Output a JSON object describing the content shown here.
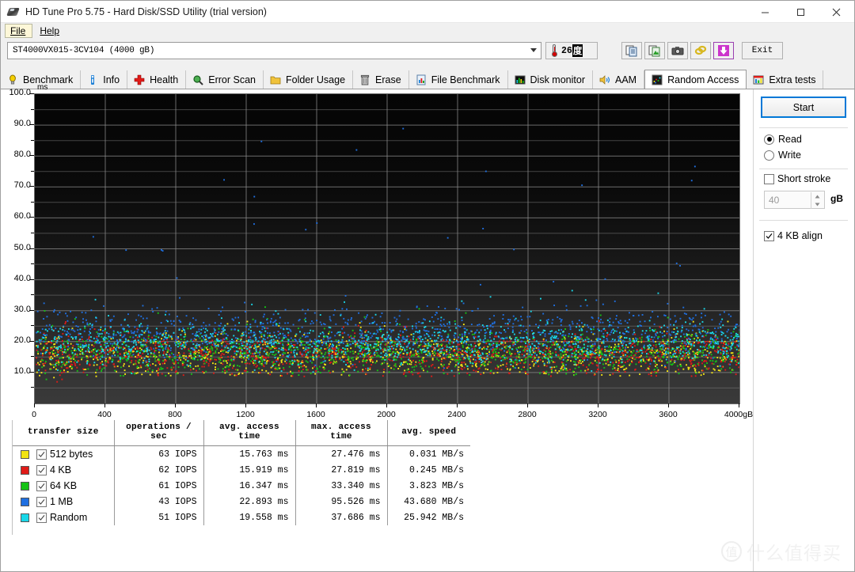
{
  "window": {
    "title": "HD Tune Pro 5.75 - Hard Disk/SSD Utility (trial version)",
    "icon": "hard-disk-icon",
    "minimize": "─",
    "maximize": "□",
    "close": "✕"
  },
  "menu": {
    "items": [
      {
        "label": "File",
        "active": true
      },
      {
        "label": "Help",
        "active": false
      }
    ]
  },
  "toolbar": {
    "drive": {
      "value": "ST4000VX015-3CV104 (4000 gB)",
      "dropdown_icon": "chevron-down-icon"
    },
    "temperature": {
      "icon": "thermometer-icon",
      "value": "26",
      "unit": "度"
    },
    "buttons": [
      {
        "name": "copy-icon",
        "label": ""
      },
      {
        "name": "copy-image-icon",
        "label": ""
      },
      {
        "name": "camera-icon",
        "label": ""
      },
      {
        "name": "link-icon",
        "label": ""
      },
      {
        "name": "download-icon",
        "label": ""
      }
    ],
    "exit_label": "Exit"
  },
  "tabs": [
    {
      "label": "Benchmark",
      "icon": "lightbulb-icon",
      "active": false
    },
    {
      "label": "Info",
      "icon": "info-icon",
      "active": false
    },
    {
      "label": "Health",
      "icon": "red-cross-icon",
      "active": false
    },
    {
      "label": "Error Scan",
      "icon": "magnifier-icon",
      "active": false
    },
    {
      "label": "Folder Usage",
      "icon": "folder-icon",
      "active": false
    },
    {
      "label": "Erase",
      "icon": "trash-icon",
      "active": false
    },
    {
      "label": "File Benchmark",
      "icon": "file-chart-icon",
      "active": false
    },
    {
      "label": "Disk monitor",
      "icon": "bar-chart-icon",
      "active": false
    },
    {
      "label": "AAM",
      "icon": "speaker-icon",
      "active": false
    },
    {
      "label": "Random Access",
      "icon": "scatter-icon",
      "active": true
    },
    {
      "label": "Extra tests",
      "icon": "chart-icon",
      "active": false
    }
  ],
  "chart_data": {
    "type": "scatter",
    "title": "",
    "xlabel": "gB",
    "ylabel": "ms",
    "yunit": "ms",
    "xunit": "gB",
    "xlim": [
      0,
      4000
    ],
    "ylim": [
      0,
      100
    ],
    "xticks": [
      0,
      400,
      800,
      1200,
      1600,
      2000,
      2400,
      2800,
      3200,
      3600,
      4000
    ],
    "xtick_labels": [
      "0",
      "400",
      "800",
      "1200",
      "1600",
      "2000",
      "2400",
      "2800",
      "3200",
      "3600",
      "4000gB"
    ],
    "yticks": [
      10,
      20,
      30,
      40,
      50,
      60,
      70,
      80,
      90,
      100
    ],
    "ytick_labels": [
      "10.0",
      "20.0",
      "30.0",
      "40.0",
      "50.0",
      "60.0",
      "70.0",
      "80.0",
      "90.0",
      "100.0"
    ],
    "grid": true,
    "background": "#0a0a0a",
    "legend_position": "below-chart",
    "series": [
      {
        "name": "512 bytes",
        "color": "#f2e313",
        "avg_ms": 15.763,
        "max_ms": 27.476,
        "count": 1100
      },
      {
        "name": "4 KB",
        "color": "#e01b18",
        "avg_ms": 15.919,
        "max_ms": 27.819,
        "count": 1100
      },
      {
        "name": "64 KB",
        "color": "#15c215",
        "avg_ms": 16.347,
        "max_ms": 33.34,
        "count": 1100
      },
      {
        "name": "1 MB",
        "color": "#1f6fe0",
        "avg_ms": 22.893,
        "max_ms": 95.526,
        "count": 1100
      },
      {
        "name": "Random",
        "color": "#19d7e8",
        "avg_ms": 19.558,
        "max_ms": 37.686,
        "count": 1100
      }
    ]
  },
  "results_table": {
    "columns": [
      "transfer size",
      "operations / sec",
      "avg. access time",
      "max. access time",
      "avg. speed"
    ],
    "rows": [
      {
        "color": "#f2e313",
        "checked": true,
        "label": "512 bytes",
        "iops": "63 IOPS",
        "avg_access": "15.763 ms",
        "max_access": "27.476 ms",
        "avg_speed": "0.031 MB/s"
      },
      {
        "color": "#e01b18",
        "checked": true,
        "label": "4 KB",
        "iops": "62 IOPS",
        "avg_access": "15.919 ms",
        "max_access": "27.819 ms",
        "avg_speed": "0.245 MB/s"
      },
      {
        "color": "#15c215",
        "checked": true,
        "label": "64 KB",
        "iops": "61 IOPS",
        "avg_access": "16.347 ms",
        "max_access": "33.340 ms",
        "avg_speed": "3.823 MB/s"
      },
      {
        "color": "#1f6fe0",
        "checked": true,
        "label": "1 MB",
        "iops": "43 IOPS",
        "avg_access": "22.893 ms",
        "max_access": "95.526 ms",
        "avg_speed": "43.680 MB/s"
      },
      {
        "color": "#19d7e8",
        "checked": true,
        "label": "Random",
        "iops": "51 IOPS",
        "avg_access": "19.558 ms",
        "max_access": "37.686 ms",
        "avg_speed": "25.942 MB/s"
      }
    ]
  },
  "side_panel": {
    "start_label": "Start",
    "mode": {
      "read_label": "Read",
      "write_label": "Write",
      "selected": "Read"
    },
    "short_stroke": {
      "label": "Short stroke",
      "checked": false,
      "value": "40",
      "unit": "gB"
    },
    "align": {
      "label": "4 KB align",
      "checked": true
    }
  },
  "watermark": {
    "mark": "值",
    "text": "什么值得买"
  },
  "colors": {
    "accent": "#0078d7",
    "plot_bg": "#0a0a0a",
    "grid": "#9a9a9a"
  }
}
